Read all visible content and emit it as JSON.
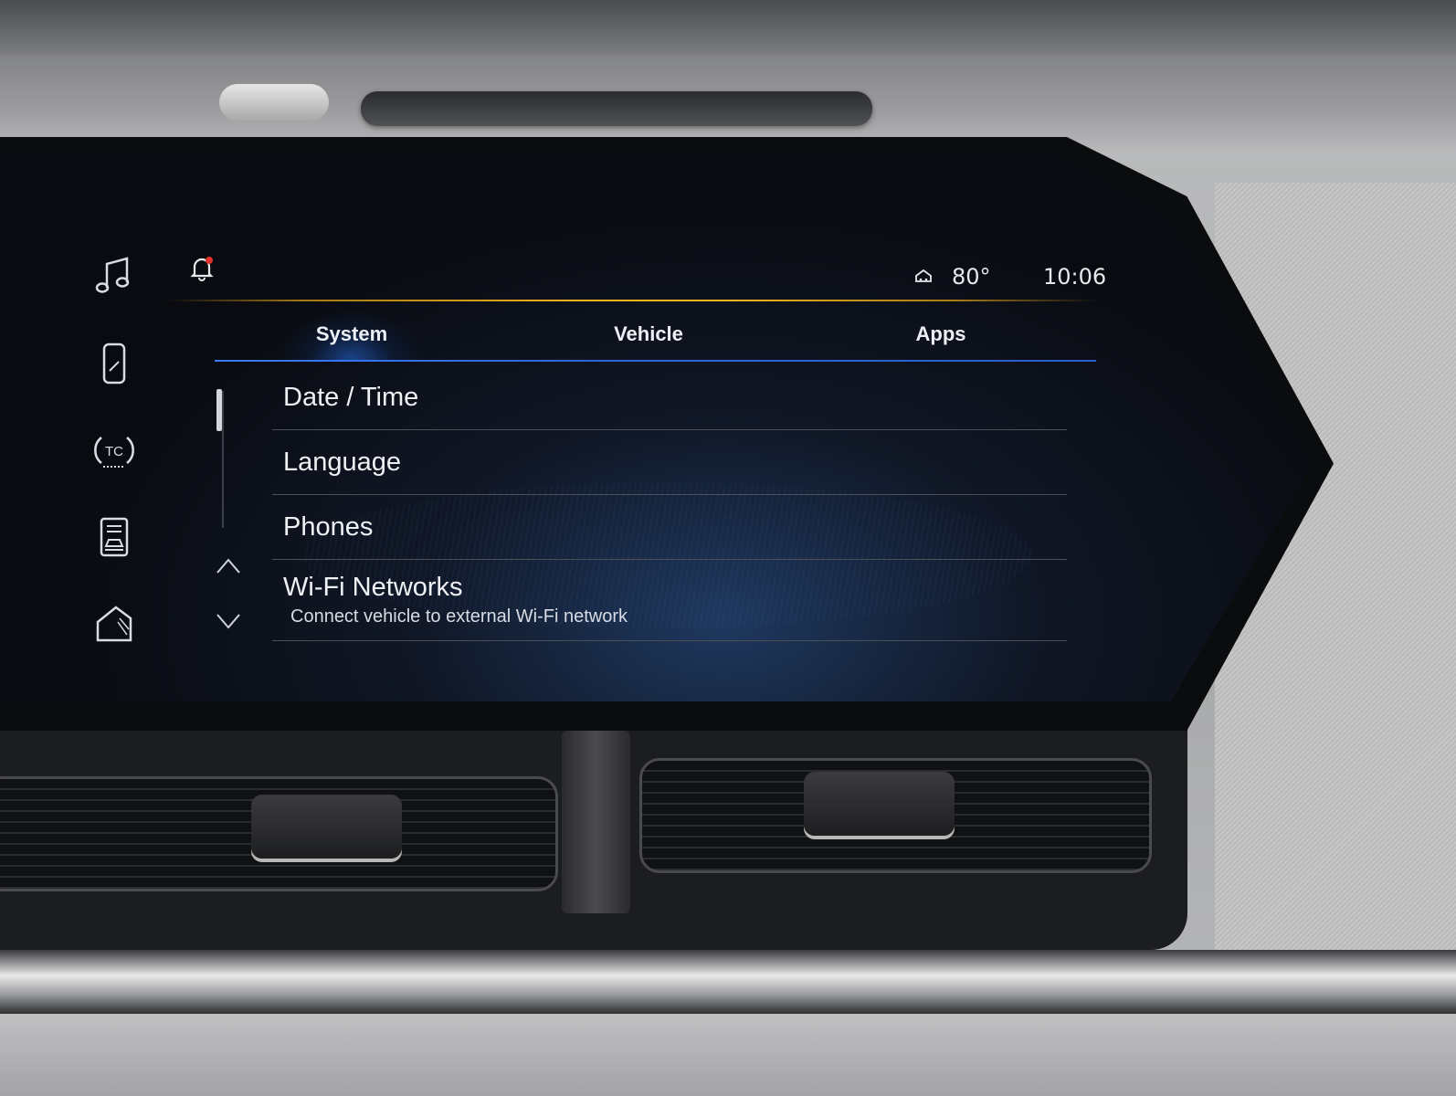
{
  "status_bar": {
    "temperature": "80°",
    "time": "10:06"
  },
  "tabs": [
    {
      "label": "System",
      "active": true
    },
    {
      "label": "Vehicle",
      "active": false
    },
    {
      "label": "Apps",
      "active": false
    }
  ],
  "list": [
    {
      "title": "Date / Time",
      "subtitle": ""
    },
    {
      "title": "Language",
      "subtitle": ""
    },
    {
      "title": "Phones",
      "subtitle": ""
    },
    {
      "title": "Wi-Fi Networks",
      "subtitle": "Connect vehicle to external Wi-Fi network"
    }
  ],
  "rail": [
    {
      "icon": "music-note-icon"
    },
    {
      "icon": "phone-icon"
    },
    {
      "icon": "traction-control-icon"
    },
    {
      "icon": "vehicle-info-icon"
    },
    {
      "icon": "home-icon"
    }
  ],
  "colors": {
    "accent_blue": "#2f66d8",
    "accent_orange": "#f2b21e",
    "notification_dot": "#e2312a",
    "text": "#eef0f4"
  }
}
